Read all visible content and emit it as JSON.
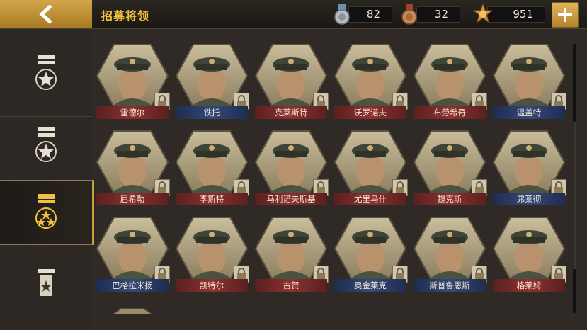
{
  "header": {
    "title": "招募将领",
    "resources": [
      {
        "icon": "silver-medal-icon",
        "value": "82"
      },
      {
        "icon": "bronze-medal-icon",
        "value": "32"
      },
      {
        "icon": "gold-star-badge-icon",
        "value": "951"
      }
    ],
    "add_label": "+"
  },
  "sidebar": {
    "tabs": [
      {
        "name": "rank-tab-1",
        "icon": "star-wreath-badge-icon",
        "active": false
      },
      {
        "name": "rank-tab-2",
        "icon": "star-wreath-badge-icon",
        "active": false
      },
      {
        "name": "rank-tab-3",
        "icon": "three-star-badge-icon",
        "active": true
      },
      {
        "name": "rank-tab-4",
        "icon": "single-star-badge-icon",
        "active": false
      }
    ]
  },
  "generals": [
    {
      "name": "雷德尔",
      "faction": "red",
      "locked": true
    },
    {
      "name": "铁托",
      "faction": "blue",
      "locked": true
    },
    {
      "name": "克莱斯特",
      "faction": "red",
      "locked": true
    },
    {
      "name": "沃罗诺夫",
      "faction": "red",
      "locked": true
    },
    {
      "name": "布劳希奇",
      "faction": "red",
      "locked": true
    },
    {
      "name": "温盖特",
      "faction": "blue",
      "locked": true
    },
    {
      "name": "屈希勒",
      "faction": "red",
      "locked": true
    },
    {
      "name": "李斯特",
      "faction": "red",
      "locked": true
    },
    {
      "name": "马利诺夫斯基",
      "faction": "red",
      "locked": true
    },
    {
      "name": "尤里乌什",
      "faction": "red",
      "locked": true
    },
    {
      "name": "魏克斯",
      "faction": "red",
      "locked": true
    },
    {
      "name": "弗莱彻",
      "faction": "blue",
      "locked": true
    },
    {
      "name": "巴格拉米扬",
      "faction": "blue",
      "locked": true
    },
    {
      "name": "凯特尔",
      "faction": "red",
      "locked": true
    },
    {
      "name": "古贺",
      "faction": "red",
      "locked": true
    },
    {
      "name": "奥金莱克",
      "faction": "blue",
      "locked": true
    },
    {
      "name": "斯普鲁恩斯",
      "faction": "blue",
      "locked": true
    },
    {
      "name": "格莱姆",
      "faction": "red",
      "locked": true
    }
  ],
  "colors": {
    "accent_gold": "#f0c040",
    "axis_red": "#8e3030",
    "allies_blue": "#34487a"
  }
}
